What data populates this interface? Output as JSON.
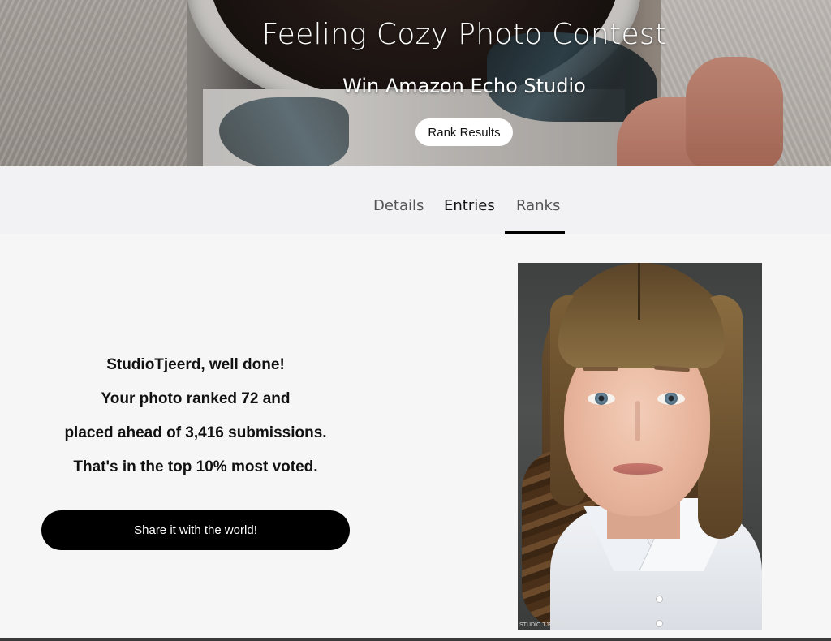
{
  "hero": {
    "title": "Feeling Cozy Photo Contest",
    "subtitle": "Win Amazon Echo Studio",
    "rank_results_label": "Rank Results"
  },
  "tabs": [
    {
      "label": "Details"
    },
    {
      "label": "Entries"
    },
    {
      "label": "Ranks",
      "active": true
    }
  ],
  "result": {
    "line1": "StudioTjeerd, well done!",
    "line2": "Your photo ranked 72 and",
    "line3": "placed ahead of 3,416 submissions.",
    "line4": "That's in the top 10% most voted.",
    "share_label": "Share it with the world!"
  },
  "photo": {
    "watermark": "STUDIO TJEERD"
  },
  "colors": {
    "accent": "#000000",
    "background": "#f6f6f6",
    "tabbar": "#f2f2f4"
  }
}
